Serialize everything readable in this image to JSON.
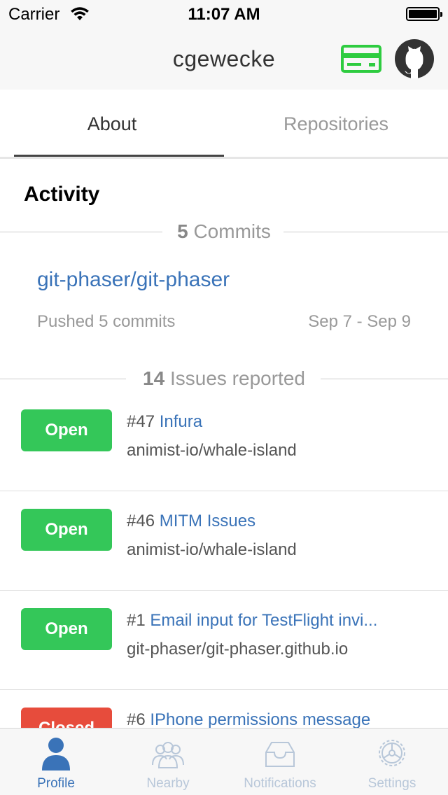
{
  "status_bar": {
    "carrier": "Carrier",
    "time": "11:07 AM"
  },
  "nav": {
    "title": "cgewecke",
    "card_icon": "credit-card-icon",
    "github_icon": "github-octocat-icon"
  },
  "tabs": [
    {
      "label": "About",
      "active": true
    },
    {
      "label": "Repositories",
      "active": false
    }
  ],
  "activity": {
    "title": "Activity",
    "commits": {
      "count": "5",
      "label": "Commits",
      "repo": "git-phaser/git-phaser",
      "pushed_text": "Pushed 5 commits",
      "date_range": "Sep 7 - Sep 9"
    },
    "issues": {
      "count": "14",
      "label": "Issues reported",
      "items": [
        {
          "status": "Open",
          "number": "#47",
          "title": "Infura",
          "repo": "animist-io/whale-island"
        },
        {
          "status": "Open",
          "number": "#46",
          "title": "MITM Issues",
          "repo": "animist-io/whale-island"
        },
        {
          "status": "Open",
          "number": "#1",
          "title": "Email input for TestFlight invi...",
          "repo": "git-phaser/git-phaser.github.io"
        },
        {
          "status": "Closed",
          "number": "#6",
          "title": "IPhone permissions message",
          "repo": ""
        }
      ]
    }
  },
  "tab_bar": [
    {
      "label": "Profile",
      "icon": "person-icon",
      "active": true
    },
    {
      "label": "Nearby",
      "icon": "people-icon",
      "active": false
    },
    {
      "label": "Notifications",
      "icon": "inbox-tray-icon",
      "active": false
    },
    {
      "label": "Settings",
      "icon": "gear-icon",
      "active": false
    }
  ],
  "colors": {
    "link_blue": "#3a73b8",
    "open_green": "#34c759",
    "closed_red": "#e74c3c",
    "card_green": "#2ecc40"
  }
}
